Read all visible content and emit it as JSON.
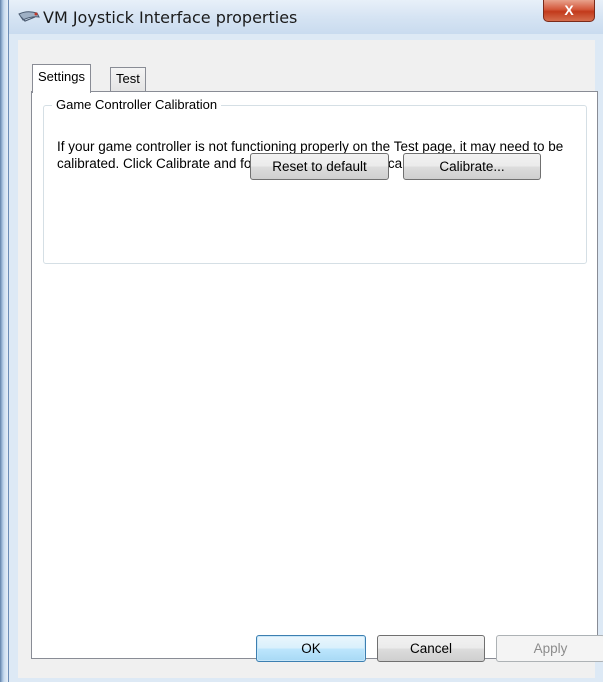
{
  "window": {
    "title": "VM Joystick Interface properties",
    "close_glyph": "X",
    "icon": "joystick-app-icon"
  },
  "tabs": [
    {
      "label": "Settings",
      "selected": true
    },
    {
      "label": "Test",
      "selected": false
    }
  ],
  "calibration": {
    "group_label": "Game Controller Calibration",
    "description": "If your game controller is not functioning properly on the Test page, it may need to be calibrated.  Click Calibrate and follow the instructions to calibrate the controller.",
    "reset_label": "Reset to default",
    "calibrate_label": "Calibrate..."
  },
  "footer": {
    "ok_label": "OK",
    "cancel_label": "Cancel",
    "apply_label": "Apply",
    "apply_enabled": false
  },
  "colors": {
    "accent": "#3c7fb1",
    "close_red": "#c23a1b",
    "frame": "#dde9f5"
  }
}
